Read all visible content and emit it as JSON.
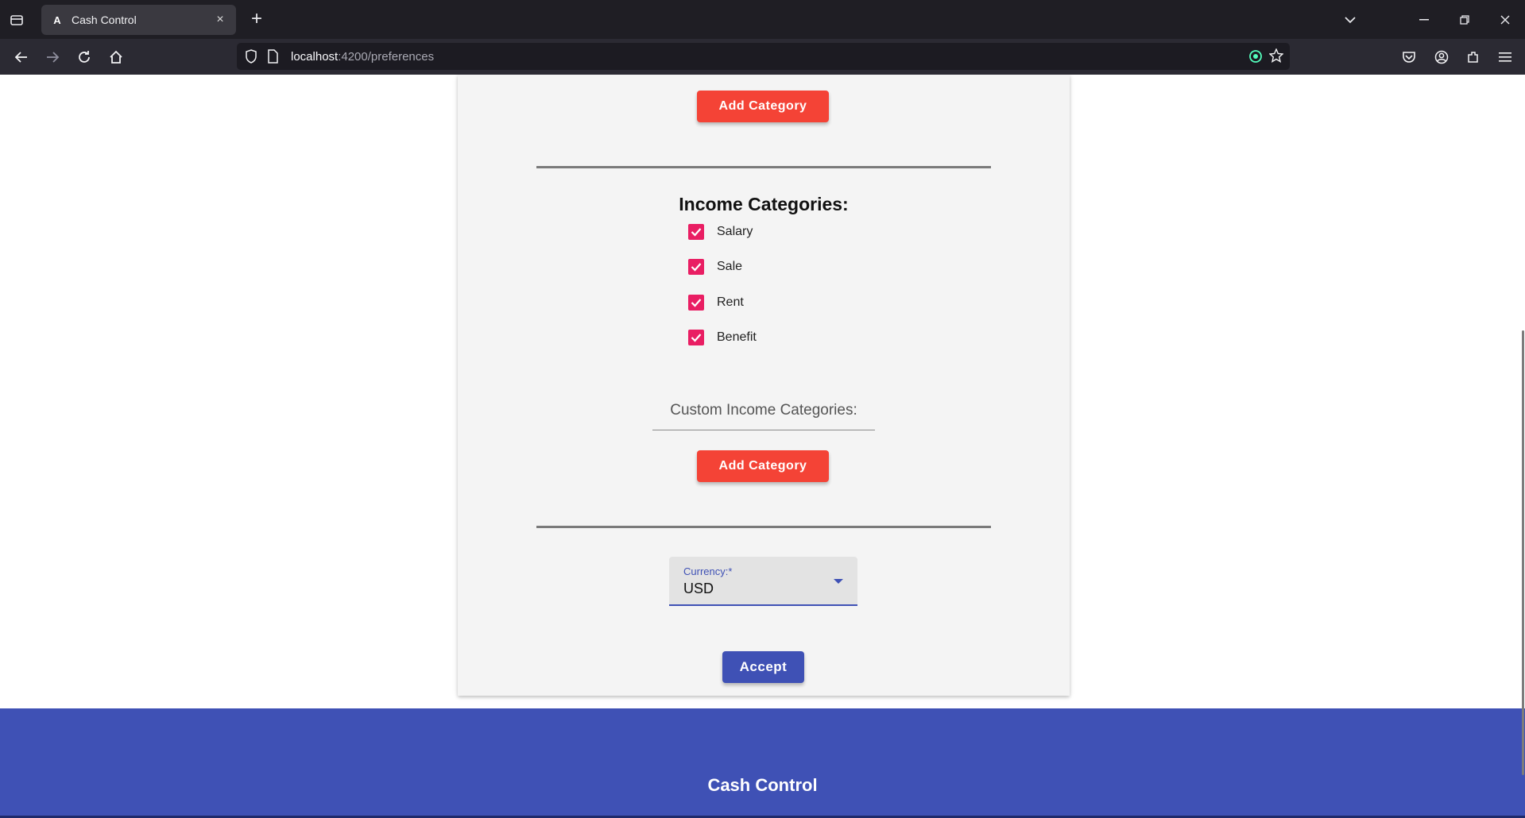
{
  "browser": {
    "tab": {
      "title": "Cash Control",
      "favicon_icon": "angular-icon"
    },
    "url": {
      "host": "localhost",
      "path": ":4200/preferences"
    }
  },
  "page": {
    "expense_add_button": "Add Category",
    "income": {
      "heading": "Income Categories:",
      "items": [
        {
          "label": "Salary",
          "checked": true
        },
        {
          "label": "Sale",
          "checked": true
        },
        {
          "label": "Rent",
          "checked": true
        },
        {
          "label": "Benefit",
          "checked": true
        }
      ],
      "custom_label": "Custom Income Categories:",
      "add_button": "Add Category"
    },
    "currency": {
      "label": "Currency:*",
      "value": "USD"
    },
    "accept_button": "Accept"
  },
  "footer": {
    "title": "Cash Control"
  },
  "colors": {
    "primary": "#3f51b5",
    "warn": "#f44336",
    "accent": "#e91e63"
  }
}
